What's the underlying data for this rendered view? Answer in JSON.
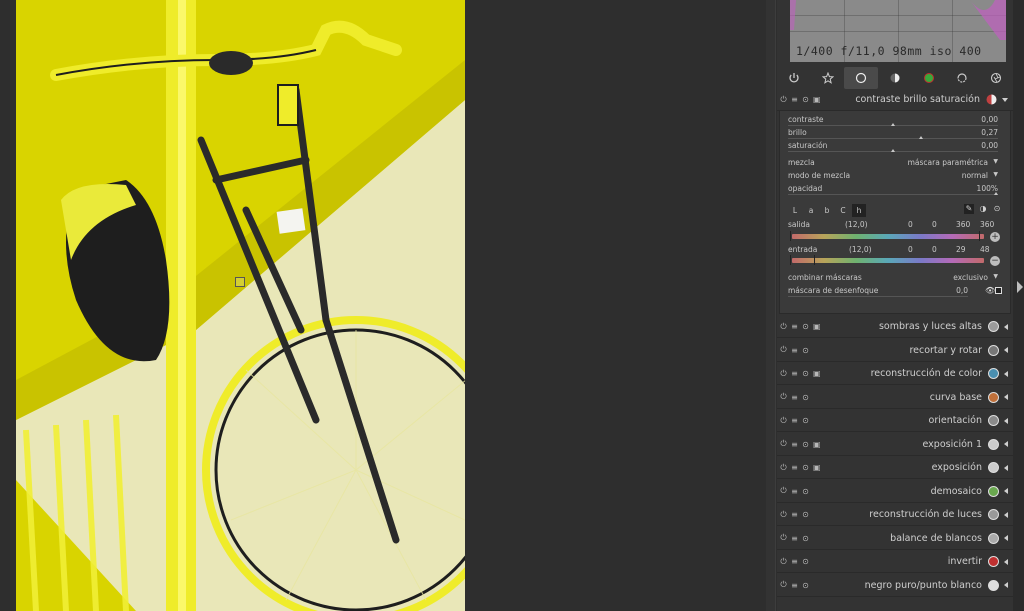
{
  "histogram": {
    "info": "1/400 f/11,0 98mm iso 400"
  },
  "group_tabs": [
    {
      "name": "power-icon"
    },
    {
      "name": "star-icon"
    },
    {
      "name": "circle-icon"
    },
    {
      "name": "half-circle-icon"
    },
    {
      "name": "color-circle-icon"
    },
    {
      "name": "rotate-icon"
    },
    {
      "name": "aperture-icon"
    }
  ],
  "active_module": {
    "title": "contraste brillo saturación",
    "sliders": [
      {
        "label": "contraste",
        "value": "0,00",
        "level": 0.5
      },
      {
        "label": "brillo",
        "value": "0,27",
        "level": 0.635
      },
      {
        "label": "saturación",
        "value": "0,00",
        "level": 0.5
      }
    ],
    "blend": {
      "mezcla_label": "mezcla",
      "mezcla_value": "máscara paramétrica",
      "modo_label": "modo de mezcla",
      "modo_value": "normal",
      "opacidad_label": "opacidad",
      "opacidad_value": "100%",
      "channels": [
        "L",
        "a",
        "b",
        "C",
        "h"
      ],
      "active_channel": "h",
      "salida_label": "salida",
      "salida_value": "(12,0)",
      "salida_nums": [
        "0",
        "0",
        "360",
        "360"
      ],
      "entrada_label": "entrada",
      "entrada_value": "(12,0)",
      "entrada_nums": [
        "0",
        "0",
        "29",
        "48"
      ],
      "combinar_label": "combinar máscaras",
      "combinar_value": "exclusivo",
      "desenfoque_label": "máscara de desenfoque",
      "desenfoque_value": "0,0"
    }
  },
  "modules": [
    {
      "title": "sombras y luces altas",
      "icon_color": "#9a9a9a",
      "has_instance": true
    },
    {
      "title": "recortar y rotar",
      "icon_color": "#777777",
      "has_instance": false
    },
    {
      "title": "reconstrucción de color",
      "icon_color": "#4a8fb0",
      "has_instance": true
    },
    {
      "title": "curva base",
      "icon_color": "#c0703a",
      "has_instance": false
    },
    {
      "title": "orientación",
      "icon_color": "#8a8a8a",
      "has_instance": false
    },
    {
      "title": "exposición 1",
      "icon_color": "#cccccc",
      "has_instance": true
    },
    {
      "title": "exposición",
      "icon_color": "#cccccc",
      "has_instance": true
    },
    {
      "title": "demosaico",
      "icon_color": "#6aa84f",
      "has_instance": false
    },
    {
      "title": "reconstrucción de luces",
      "icon_color": "#999999",
      "has_instance": false
    },
    {
      "title": "balance de blancos",
      "icon_color": "#aaaaaa",
      "has_instance": false
    },
    {
      "title": "invertir",
      "icon_color": "#c03030",
      "has_instance": false
    },
    {
      "title": "negro puro/punto blanco",
      "icon_color": "#dddddd",
      "has_instance": false
    }
  ]
}
